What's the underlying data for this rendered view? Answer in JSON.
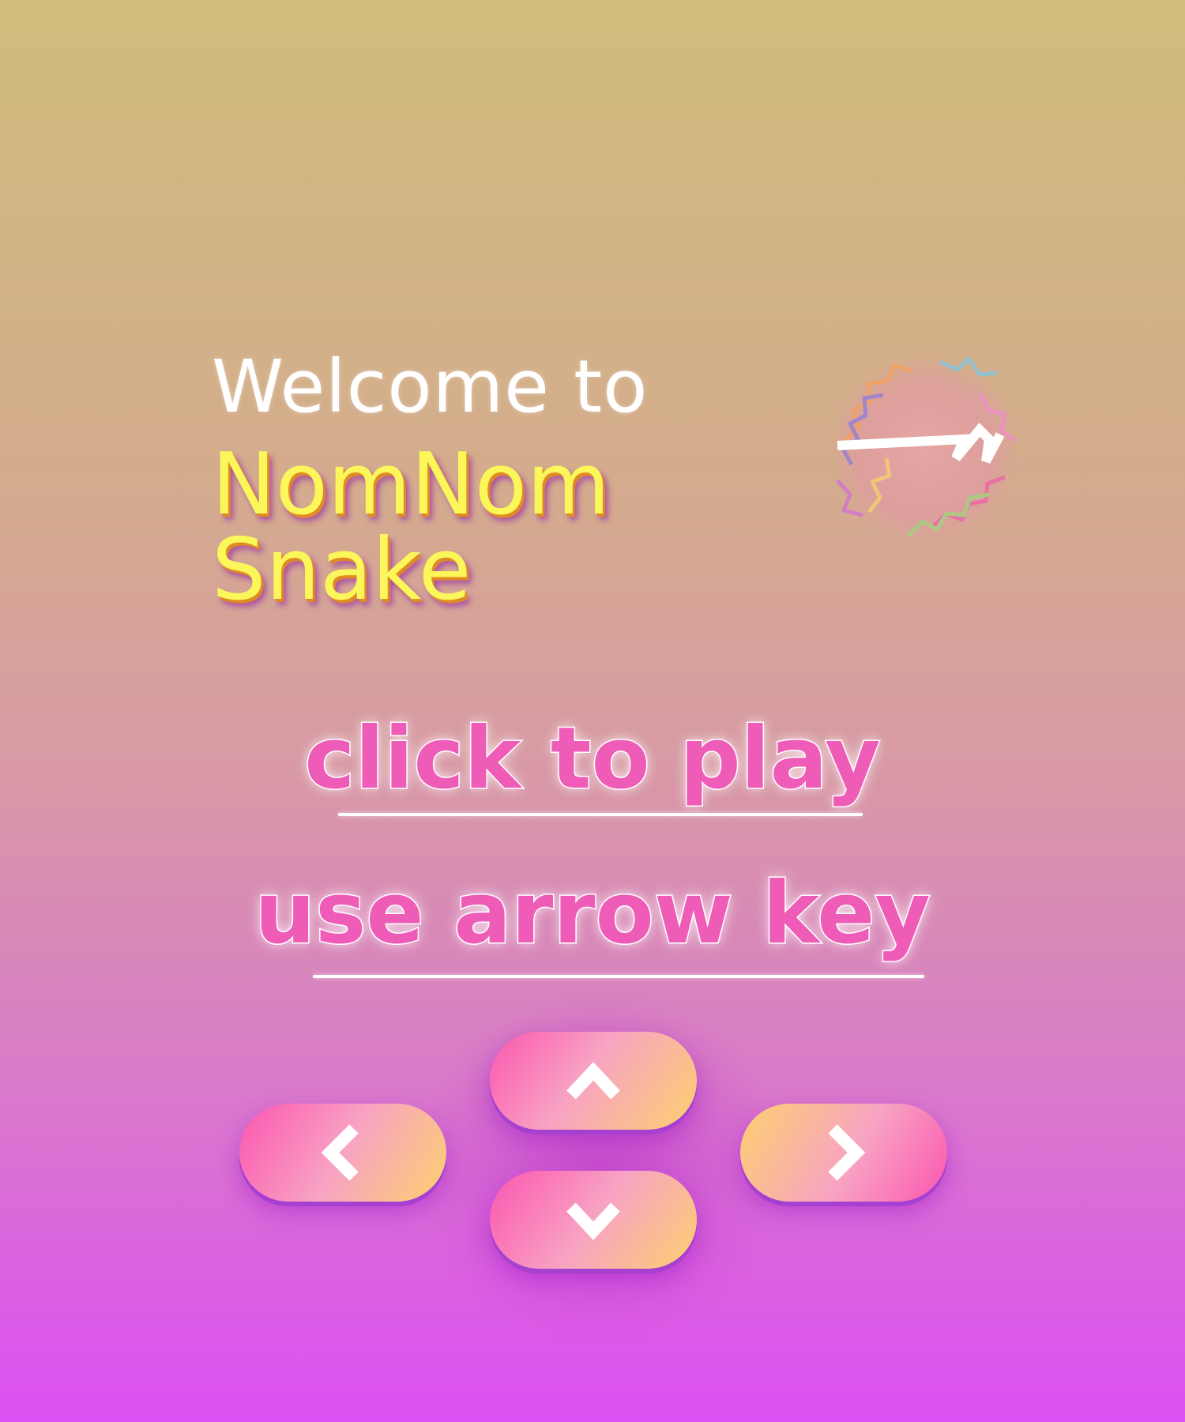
{
  "intro": {
    "welcome": "Welcome to",
    "title_line1": "NomNom",
    "title_line2": "Snake"
  },
  "instructions": {
    "play": "click to play",
    "controls": "use arrow key"
  },
  "controls": {
    "up_icon": "chevron-up-icon",
    "down_icon": "chevron-down-icon",
    "left_icon": "chevron-left-icon",
    "right_icon": "chevron-right-icon"
  },
  "colors": {
    "title_yellow": "#fbf65a",
    "title_shadow_orange": "#e08a23",
    "instruction_pink": "#ee5cb7",
    "key_pink": "#fb56b0",
    "key_yellow": "#fcd06f",
    "bg_top": "#d0bd7c",
    "bg_bottom": "#dc4ff3"
  }
}
